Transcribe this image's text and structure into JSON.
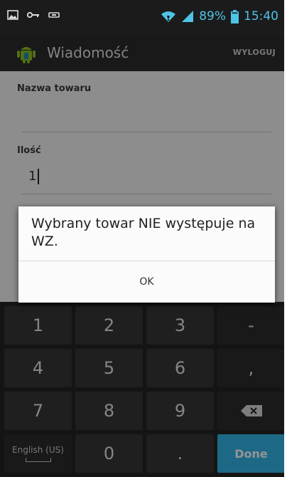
{
  "status_bar": {
    "battery": "89%",
    "time": "15:40",
    "icons": [
      "image-icon",
      "key-icon",
      "usb-icon",
      "wifi-icon",
      "signal-icon",
      "battery-icon"
    ]
  },
  "action_bar": {
    "title": "Wiadomość",
    "logout_label": "WYLOGUJ",
    "icon": "android-icon"
  },
  "form": {
    "product_name_label": "Nazwa towaru",
    "product_name_value": "",
    "quantity_label": "Ilość",
    "quantity_value": "1"
  },
  "dialog": {
    "message": "Wybrany towar NIE występuje na WZ.",
    "ok_label": "OK"
  },
  "keyboard": {
    "rows": [
      [
        "1",
        "2",
        "3",
        "-"
      ],
      [
        "4",
        "5",
        "6",
        ","
      ],
      [
        "7",
        "8",
        "9",
        "backspace"
      ],
      [
        "English (US)",
        "0",
        ".",
        "Done"
      ]
    ],
    "language_label": "English (US)",
    "done_label": "Done"
  },
  "colors": {
    "status_bar_bg": "#1b1b1b",
    "status_accent": "#4fc3e8",
    "action_bar_bg": "#2b2b2b",
    "done_key": "#33b5e5"
  }
}
